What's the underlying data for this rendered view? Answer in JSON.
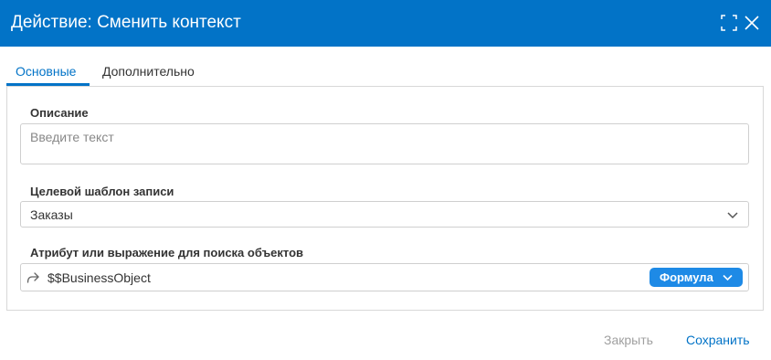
{
  "dialog": {
    "title": "Действие: Сменить контекст"
  },
  "tabs": [
    {
      "label": "Основные",
      "active": true
    },
    {
      "label": "Дополнительно",
      "active": false
    }
  ],
  "form": {
    "description": {
      "label": "Описание",
      "placeholder": "Введите текст",
      "value": ""
    },
    "target_template": {
      "label": "Целевой шаблон записи",
      "value": "Заказы"
    },
    "search_attribute": {
      "label": "Атрибут или выражение для поиска объектов",
      "value": "$$BusinessObject",
      "mode_label": "Формула"
    }
  },
  "footer": {
    "close_label": "Закрыть",
    "save_label": "Сохранить"
  },
  "colors": {
    "titlebar": "#0273c7",
    "accent": "#0273c7",
    "formula_button": "#1e8ae6",
    "disabled_text": "#a0a0a0"
  },
  "icons": {
    "expand": "expand-icon",
    "close": "close-icon",
    "dropdown": "chevron-down-icon",
    "expression": "arrow-share-icon"
  }
}
